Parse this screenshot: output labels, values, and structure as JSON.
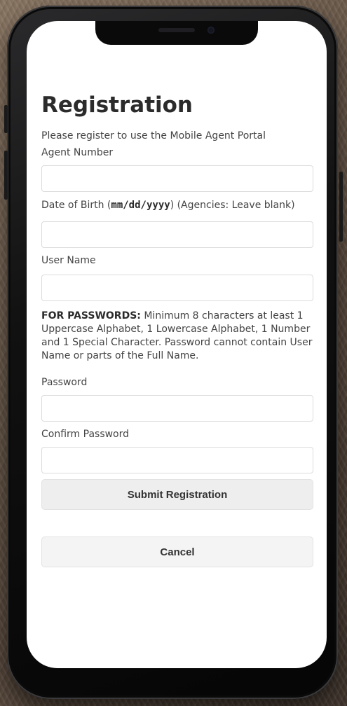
{
  "page": {
    "title": "Registration",
    "intro": "Please register to use the Mobile Agent Portal"
  },
  "form": {
    "agent_number": {
      "label": "Agent Number",
      "value": "",
      "placeholder": ""
    },
    "dob": {
      "label_prefix": "Date of Birth (",
      "label_format": "mm/dd/yyyy",
      "label_suffix": ") (Agencies: Leave blank)",
      "value": "",
      "placeholder": ""
    },
    "user_name": {
      "label": "User Name",
      "value": "",
      "placeholder": ""
    },
    "password_note": {
      "heading": "FOR PASSWORDS:",
      "text": " Minimum 8 characters at least 1 Uppercase Alphabet, 1 Lowercase Alphabet, 1 Number and 1 Special Character. Password cannot contain User Name or parts of the Full Name."
    },
    "password": {
      "label": "Password",
      "value": "",
      "placeholder": ""
    },
    "confirm_password": {
      "label": "Confirm Password",
      "value": "",
      "placeholder": ""
    }
  },
  "buttons": {
    "submit_label": "Submit Registration",
    "cancel_label": "Cancel"
  },
  "colors": {
    "screen_background": "#ffffff",
    "button_background": "#eeeeee",
    "text": "#444444",
    "heading": "#2b2b2b"
  }
}
